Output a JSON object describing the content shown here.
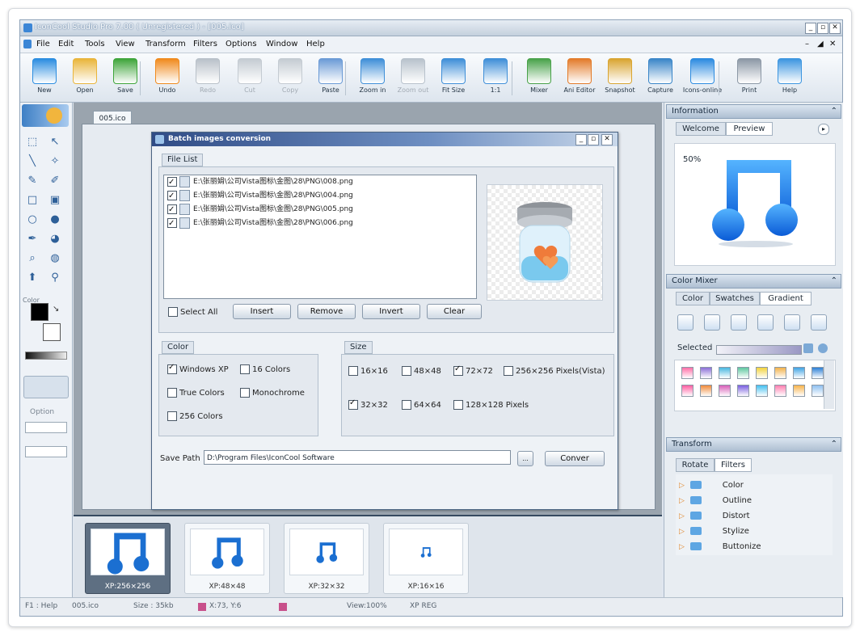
{
  "window": {
    "title": "IconCool Studio Pro 7.00 ( Unregistered ) - [005.ico]",
    "controls": [
      "_",
      "▫",
      "✕"
    ]
  },
  "menubar": {
    "items": [
      "File",
      "Edit",
      "Tools",
      "View",
      "Transform",
      "Filters",
      "Options",
      "Window",
      "Help"
    ],
    "doc_controls": [
      "–",
      "◢",
      "✕"
    ]
  },
  "toolbar": {
    "items": [
      {
        "label": "New",
        "icon": "new-file-icon",
        "color": "#2b8de0",
        "enabled": true
      },
      {
        "label": "Open",
        "icon": "open-folder-icon",
        "color": "#e9b53b",
        "enabled": true
      },
      {
        "label": "Save",
        "icon": "save-disk-icon",
        "color": "#3ea53a",
        "enabled": true
      },
      {
        "label": "Undo",
        "icon": "undo-icon",
        "color": "#f08a1d",
        "enabled": true
      },
      {
        "label": "Redo",
        "icon": "redo-icon",
        "color": "#b9c1c9",
        "enabled": false
      },
      {
        "label": "Cut",
        "icon": "cut-icon",
        "color": "#c4cbd2",
        "enabled": false
      },
      {
        "label": "Copy",
        "icon": "copy-icon",
        "color": "#c4cbd2",
        "enabled": false
      },
      {
        "label": "Paste",
        "icon": "paste-icon",
        "color": "#6b9bd6",
        "enabled": true
      },
      {
        "label": "Zoom in",
        "icon": "zoom-in-icon",
        "color": "#3f8fd8",
        "enabled": true
      },
      {
        "label": "Zoom out",
        "icon": "zoom-out-icon",
        "color": "#b8c2cc",
        "enabled": false
      },
      {
        "label": "Fit Size",
        "icon": "fit-size-icon",
        "color": "#3f8fd8",
        "enabled": true
      },
      {
        "label": "1:1",
        "icon": "actual-size-icon",
        "color": "#3f8fd8",
        "enabled": true
      },
      {
        "label": "Mixer",
        "icon": "mixer-icon",
        "color": "#49a24a",
        "enabled": true
      },
      {
        "label": "Ani Editor",
        "icon": "ani-editor-icon",
        "color": "#e37b2a",
        "enabled": true
      },
      {
        "label": "Snapshot",
        "icon": "snapshot-icon",
        "color": "#d9a531",
        "enabled": true
      },
      {
        "label": "Capture",
        "icon": "capture-icon",
        "color": "#3a86c8",
        "enabled": true
      },
      {
        "label": "Icons-online",
        "icon": "icons-online-icon",
        "color": "#2c8be0",
        "enabled": true
      },
      {
        "label": "Print",
        "icon": "print-icon",
        "color": "#8c98a6",
        "enabled": true
      },
      {
        "label": "Help",
        "icon": "help-icon",
        "color": "#3d96e0",
        "enabled": true
      }
    ]
  },
  "left_tools": {
    "tool_icons": [
      "marquee-select-icon",
      "move-pointer-icon",
      "line-icon",
      "magic-wand-icon",
      "pencil-icon",
      "brush-icon",
      "rectangle-icon",
      "filled-rectangle-icon",
      "ellipse-icon",
      "filled-ellipse-icon",
      "eyedropper-icon",
      "fill-bucket-icon",
      "zoom-tool-icon",
      "gradient-icon",
      "paint-tool-icon",
      "pin-icon"
    ],
    "color_label": "Color",
    "option_label": "Option",
    "foreground_color": "#000000",
    "background_color": "#ffffff"
  },
  "document": {
    "tab_label": "005.ico"
  },
  "dialog": {
    "title": "Batch images conversion",
    "controls": [
      "_",
      "▫",
      "✕"
    ],
    "file_list_tab": "File List",
    "files": [
      {
        "path": "E:\\张丽娟\\公司Vista图标\\金图\\28\\PNG\\008.png",
        "checked": true
      },
      {
        "path": "E:\\张丽娟\\公司Vista图标\\金图\\28\\PNG\\004.png",
        "checked": true
      },
      {
        "path": "E:\\张丽娟\\公司Vista图标\\金图\\28\\PNG\\005.png",
        "checked": true
      },
      {
        "path": "E:\\张丽娟\\公司Vista图标\\金图\\28\\PNG\\006.png",
        "checked": true
      }
    ],
    "select_all_label": "Select All",
    "select_all_checked": false,
    "buttons": {
      "insert": "Insert",
      "remove": "Remove",
      "invert": "Invert",
      "clear": "Clear"
    },
    "color_group": {
      "tab": "Color",
      "options": [
        {
          "label": "Windows XP",
          "checked": true
        },
        {
          "label": "16 Colors",
          "checked": false
        },
        {
          "label": "True Colors",
          "checked": false
        },
        {
          "label": "Monochrome",
          "checked": false
        },
        {
          "label": "256 Colors",
          "checked": false
        }
      ]
    },
    "size_group": {
      "tab": "Size",
      "options": [
        {
          "label": "16×16",
          "checked": false
        },
        {
          "label": "48×48",
          "checked": false
        },
        {
          "label": "72×72",
          "checked": true
        },
        {
          "label": "256×256 Pixels(Vista)",
          "checked": false
        },
        {
          "label": "32×32",
          "checked": true
        },
        {
          "label": "64×64",
          "checked": false
        },
        {
          "label": "128×128 Pixels",
          "checked": false
        }
      ]
    },
    "save_path_label": "Save Path",
    "save_path_value": "D:\\Program Files\\IconCool Software",
    "browse_label": "...",
    "convert_label": "Conver"
  },
  "right_panel": {
    "information": {
      "title": "Information",
      "tabs": [
        "Welcome",
        "Preview"
      ],
      "active_tab": "Preview",
      "zoom": "50%"
    },
    "color_mixer": {
      "title": "Color Mixer",
      "tabs": [
        "Color",
        "Swatches",
        "Gradient"
      ],
      "active_tab": "Gradient",
      "selected_label": "Selected",
      "gradient_colors": [
        "#ff6fa8",
        "#8b6fd8",
        "#48b7e0",
        "#5fc8a0",
        "#f3d33d",
        "#f2b24a",
        "#3fa3e4",
        "#2c7fd6",
        "#ff5fa2",
        "#f08a3a",
        "#d85fb8",
        "#7a5fe0",
        "#45c0f0",
        "#ff7fb0",
        "#f7b34c",
        "#8fc0f0"
      ]
    },
    "transform": {
      "title": "Transform",
      "tabs": [
        "Rotate",
        "Filters"
      ],
      "active_tab": "Filters",
      "items": [
        "Color",
        "Outline",
        "Distort",
        "Stylize",
        "Buttonize"
      ]
    }
  },
  "thumbnails": [
    {
      "caption": "XP:256×256",
      "selected": true
    },
    {
      "caption": "XP:48×48",
      "selected": false
    },
    {
      "caption": "XP:32×32",
      "selected": false
    },
    {
      "caption": "XP:16×16",
      "selected": false
    }
  ],
  "statusbar": {
    "help": "F1 : Help",
    "file": "005.ico",
    "size": "Size : 35kb",
    "coords": "X:73, Y:6",
    "view": "View:100%",
    "format": "XP REG"
  }
}
